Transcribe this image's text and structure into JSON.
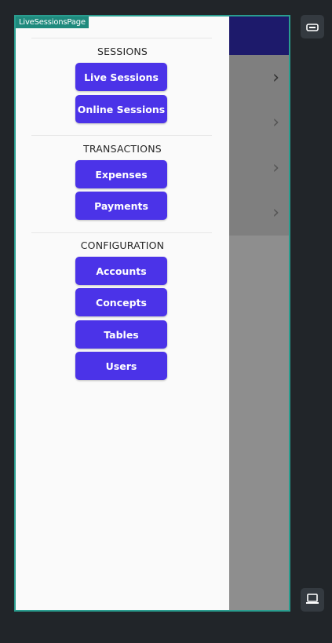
{
  "frame": {
    "tag": "LiveSessionsPage"
  },
  "list": {
    "rows": [
      {
        "chevron": "chevron-right-icon"
      },
      {
        "chevron": "chevron-right-icon"
      },
      {
        "chevron": "chevron-right-icon"
      },
      {
        "chevron": "chevron-right-icon"
      }
    ]
  },
  "drawer": {
    "sections": {
      "sessions": {
        "title": "SESSIONS",
        "items": {
          "live": "Live Sessions",
          "online": "Online Sessions"
        }
      },
      "transactions": {
        "title": "TRANSACTIONS",
        "items": {
          "expenses": "Expenses",
          "payments": "Payments"
        }
      },
      "configuration": {
        "title": "CONFIGURATION",
        "items": {
          "accounts": "Accounts",
          "concepts": "Concepts",
          "tables": "Tables",
          "users": "Users"
        }
      }
    }
  },
  "colors": {
    "accent": "#4b33e8",
    "appbar": "#1d1a6b",
    "frame_border": "#2a9d8f",
    "background": "#212529"
  },
  "toolbar": {
    "top_icon": "device-toggle-icon",
    "bottom_icon": "laptop-icon"
  }
}
